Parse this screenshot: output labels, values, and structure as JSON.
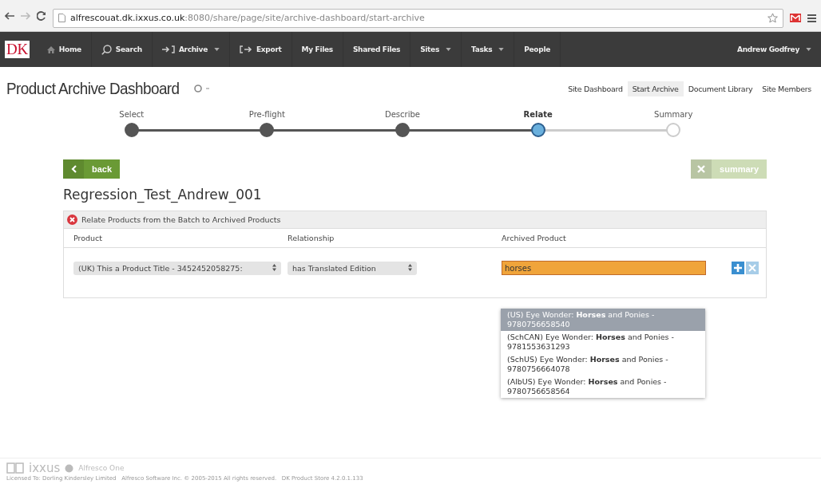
{
  "browser": {
    "url_host": "alfrescouat.dk.ixxus.co.uk",
    "url_path": ":8080/share/page/site/archive-dashboard/start-archive"
  },
  "nav": {
    "logo": "DK",
    "items": [
      {
        "label": "Home",
        "dropdown": false
      },
      {
        "label": "Search",
        "dropdown": false
      },
      {
        "label": "Archive",
        "dropdown": true
      },
      {
        "label": "Export",
        "dropdown": false
      },
      {
        "label": "My Files",
        "dropdown": false
      },
      {
        "label": "Shared Files",
        "dropdown": false
      },
      {
        "label": "Sites",
        "dropdown": true
      },
      {
        "label": "Tasks",
        "dropdown": true
      },
      {
        "label": "People",
        "dropdown": false
      }
    ],
    "user": {
      "label": "Andrew Godfrey",
      "dropdown": true
    }
  },
  "site": {
    "title": "Product Archive Dashboard",
    "links": [
      {
        "label": "Site Dashboard",
        "selected": false
      },
      {
        "label": "Start Archive",
        "selected": true
      },
      {
        "label": "Document Library",
        "selected": false
      },
      {
        "label": "Site Members",
        "selected": false
      }
    ]
  },
  "steps": [
    {
      "label": "Select",
      "completed": true,
      "selected": false
    },
    {
      "label": "Pre-flight",
      "completed": true,
      "selected": false
    },
    {
      "label": "Describe",
      "completed": true,
      "selected": false
    },
    {
      "label": "Relate",
      "completed": false,
      "selected": true
    },
    {
      "label": "Summary",
      "completed": false,
      "selected": false
    }
  ],
  "back_button": {
    "label": "back",
    "disabled": false
  },
  "summary_button": {
    "label": "summary",
    "disabled": true
  },
  "batch_title": "Regression_Test_Andrew_001",
  "panel": {
    "message": "Relate Products from the Batch to Archived Products",
    "error": true,
    "columns": [
      "Product",
      "Relationship",
      "Archived Product"
    ],
    "row": {
      "product": "(UK) This a Product Title - 3452452058275:",
      "relationship": "has Translated Edition",
      "archived_product": "horses"
    },
    "suggestions": [
      {
        "text": "(US) Eye Wonder: **Horses** and Ponies - 9780756658540",
        "selected": true
      },
      {
        "text": "(SchCAN) Eye Wonder: **Horses** and Ponies - 9781553631293",
        "selected": false
      },
      {
        "text": "(SchUS) Eye Wonder: **Horses** and Ponies - 9780756664078",
        "selected": false
      },
      {
        "text": "(AlbUS) Eye Wonder: **Horses** and Ponies - 9780756658564",
        "selected": false
      }
    ]
  },
  "footer": {
    "brand": "ixxus",
    "partner": "Alfresco One",
    "legal": "Licensed To: Dorling Kindersley Limited   Alfresco Software Inc. © 2005-2015 All rights reserved.   DK Product Store 4.2.0.1.133"
  }
}
